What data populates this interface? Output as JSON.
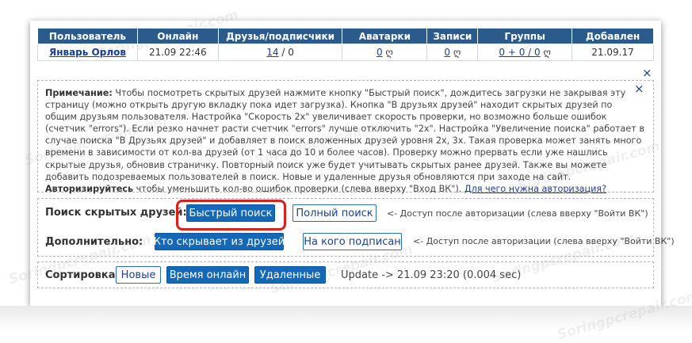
{
  "table": {
    "headers": [
      "Пользователь",
      "Онлайн",
      "Друзья/подписчики",
      "Аватарки",
      "Записи",
      "Группы",
      "Добавлен"
    ],
    "row": {
      "user": "Январь Орлов",
      "online": "21.09 22:46",
      "friends_link": "14",
      "friends_rest": " / 0",
      "avatars": "0",
      "posts": "0",
      "groups": "0 + 0 / 0",
      "heart": "ღ",
      "added": "21.09.17"
    }
  },
  "close_symbol": "×",
  "note": {
    "label": "Примечание:",
    "text": " Чтобы посмотреть скрытых друзей нажмите кнопку \"Быстрый поиск\", дождитесь загрузки не закрывая эту страницу (можно открыть другую вкладку пока идет загрузка). Кнопка \"В друзьях друзей\" находит скрытых друзей по общим друзьям пользователя. Настройка \"Скорость 2х\" увеличивает скорость проверки, но возможно больше ошибок (счетчик \"errors\"). Если резко начнет расти счетчик \"errors\" лучше отключить \"2х\". Настройка \"Увеличение поиска\" работает в случае поиска \"В Друзьях друзей\" и добавляет в поиск вложенных друзей уровня 2х, 3х. Такая проверка может занять много времени в зависимости от кол-ва друзей (от 1 часа до 10 и более часов). Проверку можно прервать если уже нашлись скрытые друзья, обновив страничку. Повторный поиск уже будет учитывать скрытых ранее друзей. Также вы можете добавить подозреваемых пользователей в поиск. Новые и удаленные друзья обновляются при заходе на сайт.",
    "auth_bold": "Авторизируйтесь",
    "auth_text": " чтобы уменьшить кол-во ошибок проверки (слева вверху \"Вход ВК\"). ",
    "auth_link": "Для чего нужна авторизация?"
  },
  "search": {
    "label": "Поиск скрытых друзей:",
    "quick_button": "Быстрый поиск",
    "full_button": "Полный поиск",
    "hint": "<- Доступ после авторизации (слева вверху \"Войти ВК\")"
  },
  "extra": {
    "label": "Дополнительно:",
    "hidden_from_button": "Кто скрывает из друзей",
    "subscribed_button": "На кого подписан",
    "hint": "<- Доступ после авторизации (слева вверху \"Войти ВК\")"
  },
  "sort": {
    "label": "Сортировка:",
    "new_button": "Новые",
    "online_button": "Время онлайн",
    "deleted_button": "Удаленные",
    "update": "Update -> 21.09 23:20 (0.004 sec)"
  },
  "watermark": "Soringpcrepair.com",
  "colors": {
    "header_bg": "#2b5a8c",
    "button_bg": "#1468b8",
    "link": "#1d3f8a",
    "highlight": "#d9201a"
  }
}
